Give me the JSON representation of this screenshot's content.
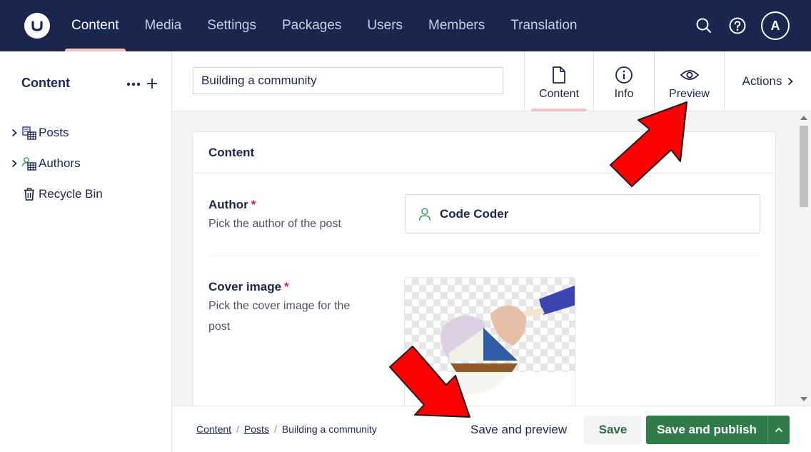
{
  "topbar": {
    "nav": [
      "Content",
      "Media",
      "Settings",
      "Packages",
      "Users",
      "Members",
      "Translation"
    ],
    "active_nav": "Content",
    "avatar_initial": "A",
    "icons": [
      "search-icon",
      "help-icon"
    ]
  },
  "sidebar": {
    "title": "Content",
    "items": [
      {
        "label": "Posts",
        "icon": "posts-collection-icon",
        "expandable": true
      },
      {
        "label": "Authors",
        "icon": "authors-collection-icon",
        "expandable": true
      },
      {
        "label": "Recycle Bin",
        "icon": "trash-icon",
        "expandable": false
      }
    ]
  },
  "header": {
    "document_name": "Building a community",
    "tabs": [
      {
        "label": "Content",
        "icon": "document-icon",
        "active": true
      },
      {
        "label": "Info",
        "icon": "info-icon",
        "active": false
      },
      {
        "label": "Preview",
        "icon": "eye-icon",
        "active": false
      }
    ],
    "actions_label": "Actions"
  },
  "card": {
    "title": "Content",
    "author": {
      "label": "Author",
      "required_mark": "*",
      "description": "Pick the author of the post",
      "value": "Code Coder"
    },
    "cover_image": {
      "label": "Cover image",
      "required_mark": "*",
      "description": "Pick the cover image for the post"
    }
  },
  "footer": {
    "breadcrumbs": [
      "Content",
      "Posts",
      "Building a community"
    ],
    "save_and_preview": "Save and preview",
    "save": "Save",
    "save_and_publish": "Save and publish"
  },
  "colors": {
    "topbar": "#1b264f",
    "active_indicator": "#f5c1bc",
    "publish_button": "#2f7c4a",
    "required": "#d42054",
    "annotation_arrow": "#ff0000"
  }
}
